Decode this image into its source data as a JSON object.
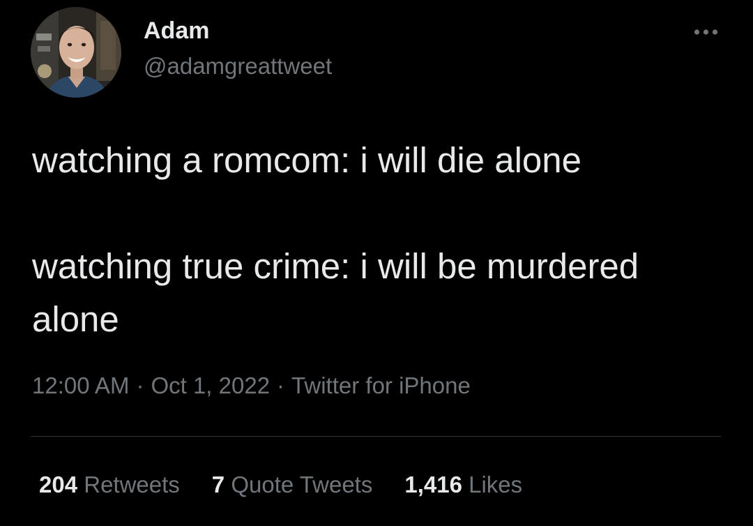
{
  "author": {
    "display_name": "Adam",
    "handle": "@adamgreattweet"
  },
  "icons": {
    "more": "more-horizontal-icon"
  },
  "tweet": {
    "paragraphs": [
      "watching a romcom: i will die alone",
      "watching true crime: i will be murdered alone"
    ]
  },
  "meta": {
    "time": "12:00 AM",
    "date": "Oct 1, 2022",
    "source": "Twitter for iPhone",
    "separator": "·"
  },
  "stats": [
    {
      "count": "204",
      "label": "Retweets"
    },
    {
      "count": "7",
      "label": "Quote Tweets"
    },
    {
      "count": "1,416",
      "label": "Likes"
    }
  ],
  "colors": {
    "background": "#000000",
    "text_primary": "#e7e9ea",
    "text_secondary": "#71767b",
    "divider": "#333639"
  }
}
